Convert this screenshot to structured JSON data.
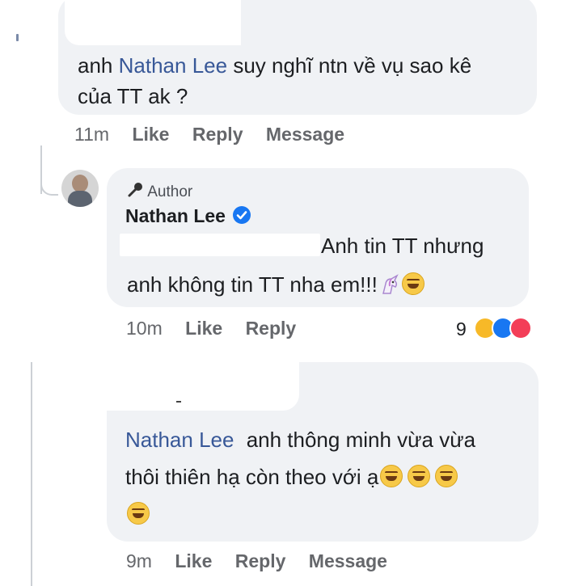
{
  "comment1": {
    "line1_prefix": "anh",
    "mention": "Nathan Lee",
    "line1_suffix": "suy nghĩ ntn về vụ sao kê",
    "line2": "của TT ak ?",
    "time": "11m",
    "actions": [
      "Like",
      "Reply",
      "Message"
    ]
  },
  "reply1": {
    "badge": "Author",
    "author": "Nathan Lee",
    "line1": "Anh tin TT nhưng",
    "line2": "anh không tin TT nha em!!!",
    "time": "10m",
    "actions": [
      "Like",
      "Reply"
    ],
    "reaction_count": "9",
    "reaction_icons": [
      "haha-icon",
      "like-icon",
      "love-icon"
    ],
    "colors": {
      "verified": "#1877f2",
      "like": "#1877f2",
      "love": "#f33e58",
      "haha": "#f7b928"
    }
  },
  "reply2": {
    "mention": "Nathan Lee",
    "line1_suffix": "anh thông minh vừa vừa",
    "line2": "thôi thiên hạ còn theo với ạ",
    "time": "9m",
    "actions": [
      "Like",
      "Reply",
      "Message"
    ]
  }
}
